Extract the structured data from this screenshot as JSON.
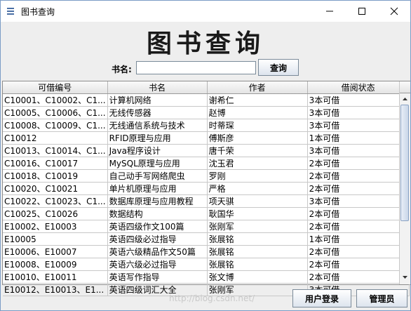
{
  "window": {
    "title": "图书查询"
  },
  "heading": "图书查询",
  "search": {
    "label": "书名:",
    "value": "",
    "button_label": "查询"
  },
  "table": {
    "columns": [
      "可借编号",
      "书名",
      "作者",
      "借阅状态"
    ],
    "rows": [
      [
        "C10001、C10002、C1...",
        "计算机网络",
        "谢希仁",
        "3本可借"
      ],
      [
        "C10005、C10006、C1...",
        "无线传感器",
        "赵博",
        "3本可借"
      ],
      [
        "C10008、C10009、C1...",
        "无线通信系统与技术",
        "时蒂琛",
        "3本可借"
      ],
      [
        "C10012",
        "RFID原理与应用",
        "傅斯彦",
        "1本可借"
      ],
      [
        "C10013、C10014、C1...",
        "Java程序设计",
        "唐千荣",
        "3本可借"
      ],
      [
        "C10016、C10017",
        "MySQL原理与应用",
        "沈玉君",
        "2本可借"
      ],
      [
        "C10018、C10019",
        "自己动手写网络爬虫",
        "罗刚",
        "2本可借"
      ],
      [
        "C10020、C10021",
        "单片机原理与应用",
        "严格",
        "2本可借"
      ],
      [
        "C10022、C10023、C1...",
        "数据库原理与应用教程",
        "项天骐",
        "3本可借"
      ],
      [
        "C10025、C10026",
        "数据结构",
        "耿国华",
        "2本可借"
      ],
      [
        "E10002、E10003",
        "英语四级作文100篇",
        "张刚军",
        "2本可借"
      ],
      [
        "E10005",
        "英语四级必过指导",
        "张展铭",
        "1本可借"
      ],
      [
        "E10006、E10007",
        "英语六级精品作文50篇",
        "张展铭",
        "2本可借"
      ],
      [
        "E10008、E10009",
        "英语六级必过指导",
        "张展铭",
        "2本可借"
      ],
      [
        "E10010、E10011",
        "英语写作指导",
        "张文博",
        "2本可借"
      ],
      [
        "E10012、E10013、E1...",
        "英语四级词汇大全",
        "张刚军",
        "3本可借"
      ]
    ]
  },
  "buttons": {
    "login": "用户登录",
    "admin": "管理员"
  },
  "watermark": "http://blog.csdn.net/"
}
